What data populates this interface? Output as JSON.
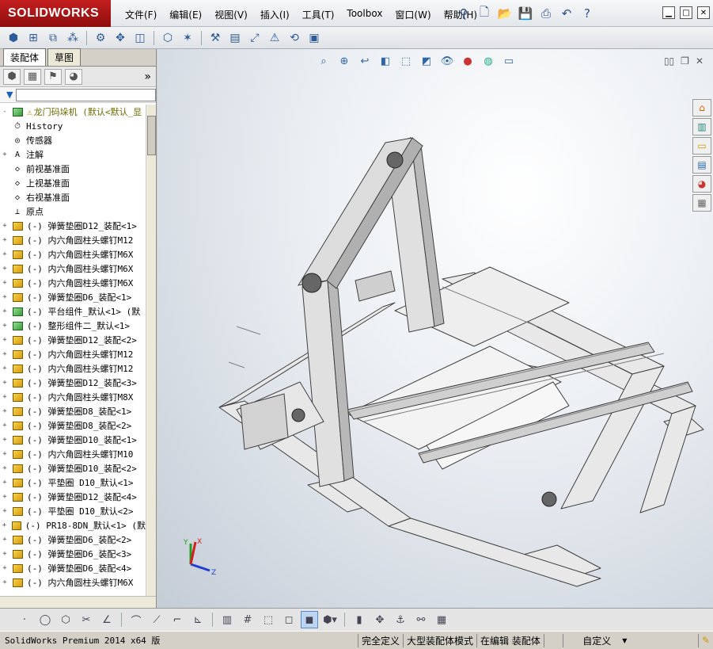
{
  "app": {
    "logo": "SOLIDWORKS"
  },
  "menus": [
    "文件(F)",
    "编辑(E)",
    "视图(V)",
    "插入(I)",
    "工具(T)",
    "Toolbox",
    "窗口(W)",
    "帮助(H)"
  ],
  "quick_access_icons": [
    "pin-icon",
    "new-document-icon",
    "open-icon",
    "save-icon",
    "print-icon",
    "undo-icon",
    "help-icon"
  ],
  "window_controls": {
    "minimize": "▁",
    "maximize": "□",
    "close": "✕"
  },
  "toolbar_icons": [
    "assembly-icon",
    "insert-component-icon",
    "mate-icon",
    "pattern-icon",
    "smart-fasteners-icon",
    "move-component-icon",
    "show-hidden-icon",
    "assembly-features-icon",
    "reference-geometry-icon",
    "new-motion-study-icon",
    "bill-of-materials-icon",
    "exploded-view-icon",
    "interference-icon",
    "rebuild-icon",
    "options-icon"
  ],
  "panel": {
    "tabs": [
      "装配体",
      "草图"
    ],
    "active_tab": 0,
    "feature_manager_icons": [
      "feature-manager-icon",
      "property-manager-icon",
      "configuration-manager-icon",
      "display-manager-icon"
    ],
    "expand_label": "»"
  },
  "tree": {
    "root": "龙门码垛机  (默认<默认_显",
    "items": [
      {
        "label": "History",
        "icon": "history",
        "exp": ""
      },
      {
        "label": "传感器",
        "icon": "sensor",
        "exp": ""
      },
      {
        "label": "注解",
        "icon": "annotation",
        "exp": "+"
      },
      {
        "label": "前视基准面",
        "icon": "plane",
        "exp": ""
      },
      {
        "label": "上视基准面",
        "icon": "plane",
        "exp": ""
      },
      {
        "label": "右视基准面",
        "icon": "plane",
        "exp": ""
      },
      {
        "label": "原点",
        "icon": "origin",
        "exp": ""
      },
      {
        "label": "(-) 弹簧垫圈D12_装配<1>",
        "icon": "part",
        "exp": "+"
      },
      {
        "label": "(-) 内六角圆柱头螺钉M12",
        "icon": "part",
        "exp": "+"
      },
      {
        "label": "(-) 内六角圆柱头螺钉M6X",
        "icon": "part",
        "exp": "+"
      },
      {
        "label": "(-) 内六角圆柱头螺钉M6X",
        "icon": "part",
        "exp": "+"
      },
      {
        "label": "(-) 内六角圆柱头螺钉M6X",
        "icon": "part",
        "exp": "+"
      },
      {
        "label": "(-) 弹簧垫圈D6_装配<1>",
        "icon": "part",
        "exp": "+"
      },
      {
        "label": "(-) 平台组件_默认<1> (默",
        "icon": "assembly",
        "exp": "+"
      },
      {
        "label": "(-) 整形组件二_默认<1>",
        "icon": "assembly",
        "exp": "+"
      },
      {
        "label": "(-) 弹簧垫圈D12_装配<2>",
        "icon": "part",
        "exp": "+"
      },
      {
        "label": "(-) 内六角圆柱头螺钉M12",
        "icon": "part",
        "exp": "+"
      },
      {
        "label": "(-) 内六角圆柱头螺钉M12",
        "icon": "part",
        "exp": "+"
      },
      {
        "label": "(-) 弹簧垫圈D12_装配<3>",
        "icon": "part",
        "exp": "+"
      },
      {
        "label": "(-) 内六角圆柱头螺钉M8X",
        "icon": "part",
        "exp": "+"
      },
      {
        "label": "(-) 弹簧垫圈D8_装配<1>",
        "icon": "part",
        "exp": "+"
      },
      {
        "label": "(-) 弹簧垫圈D8_装配<2>",
        "icon": "part",
        "exp": "+"
      },
      {
        "label": "(-) 弹簧垫圈D10_装配<1>",
        "icon": "part",
        "exp": "+"
      },
      {
        "label": "(-) 内六角圆柱头螺钉M10",
        "icon": "part",
        "exp": "+"
      },
      {
        "label": "(-) 弹簧垫圈D10_装配<2>",
        "icon": "part",
        "exp": "+"
      },
      {
        "label": "(-) 平垫圈 D10_默认<1>",
        "icon": "part",
        "exp": "+"
      },
      {
        "label": "(-) 弹簧垫圈D12_装配<4>",
        "icon": "part",
        "exp": "+"
      },
      {
        "label": "(-) 平垫圈 D10_默认<2>",
        "icon": "part",
        "exp": "+"
      },
      {
        "label": "(-) PR18-8DN_默认<1> (默",
        "icon": "part",
        "exp": "+"
      },
      {
        "label": "(-) 弹簧垫圈D6_装配<2>",
        "icon": "part",
        "exp": "+"
      },
      {
        "label": "(-) 弹簧垫圈D6_装配<3>",
        "icon": "part",
        "exp": "+"
      },
      {
        "label": "(-) 弹簧垫圈D6_装配<4>",
        "icon": "part",
        "exp": "+"
      },
      {
        "label": "(-) 内六角圆柱头螺钉M6X",
        "icon": "part",
        "exp": "+"
      }
    ]
  },
  "headsup_icons": [
    "zoom-to-fit-icon",
    "zoom-to-area-icon",
    "previous-view-icon",
    "section-view-icon",
    "view-orientation-icon",
    "display-style-icon",
    "hide-show-items-icon",
    "edit-appearance-icon",
    "apply-scene-icon",
    "view-settings-icon"
  ],
  "taskpane_icons": [
    "home-icon",
    "resources-icon",
    "design-library-icon",
    "file-explorer-icon",
    "appearances-icon",
    "custom-properties-icon"
  ],
  "sketch_toolbar_icons": [
    "point-icon",
    "circle-icon",
    "polygon-icon",
    "trim-icon",
    "line-icon",
    "fillet-icon",
    "chamfer-icon",
    "corner-icon",
    "dimension-icon",
    "grid-icon",
    "cube-icon",
    "box-icon",
    "shaded-icon",
    "dropdown-icon",
    "parts-icon",
    "move-icon",
    "anchor-icon",
    "mate-ref-icon",
    "table-icon"
  ],
  "status": {
    "app": "SolidWorks Premium 2014 x64 版",
    "defined": "完全定义",
    "mode": "大型装配体模式",
    "editing": "在编辑 装配体",
    "units": "自定义",
    "units_arrow": "▼"
  },
  "triad": {
    "x": "X",
    "y": "Y",
    "z": "Z"
  }
}
